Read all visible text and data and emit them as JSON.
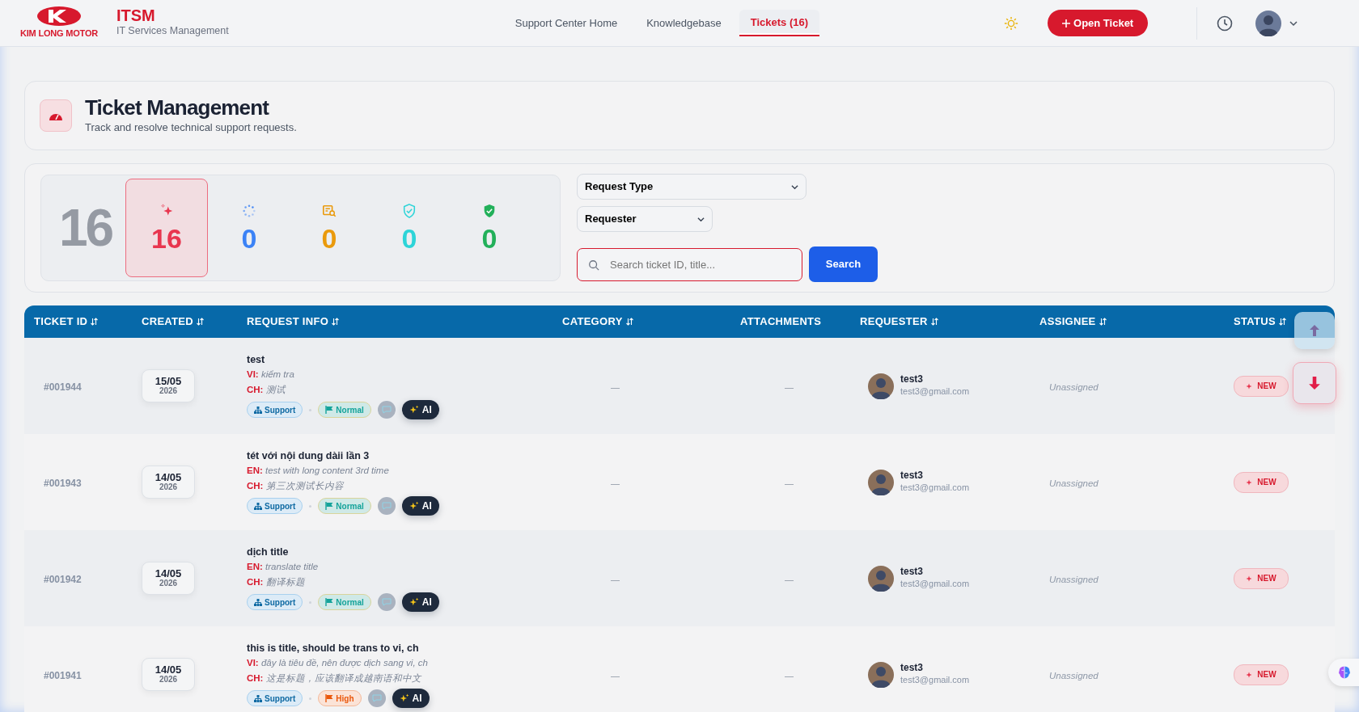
{
  "header": {
    "logo_text": "KIM LONG MOTOR",
    "app_title": "ITSM",
    "app_subtitle": "IT Services Management",
    "open_ticket": "Open Ticket"
  },
  "nav": [
    {
      "label": "Support Center Home",
      "selected": false
    },
    {
      "label": "Knowledgebase",
      "selected": false
    },
    {
      "label": "Tickets (16)",
      "selected": true
    }
  ],
  "page": {
    "title": "Ticket Management",
    "subtitle": "Track and resolve technical support requests."
  },
  "stats": {
    "total": "16",
    "items": [
      {
        "kind": "new",
        "value": "16",
        "color": "#e8364f",
        "selected": true
      },
      {
        "kind": "progress",
        "value": "0",
        "color": "#3b82f6",
        "selected": false
      },
      {
        "kind": "review",
        "value": "0",
        "color": "#ea9a0c",
        "selected": false
      },
      {
        "kind": "resolved",
        "value": "0",
        "color": "#2dd4d8",
        "selected": false
      },
      {
        "kind": "closed",
        "value": "0",
        "color": "#22b05a",
        "selected": false
      }
    ]
  },
  "filters": [
    {
      "label": "Request Type"
    },
    {
      "label": "Requester"
    }
  ],
  "search": {
    "placeholder": "Search ticket ID, title...",
    "button": "Search"
  },
  "table": {
    "columns": [
      {
        "label": "TICKET ID",
        "sortable": true
      },
      {
        "label": "CREATED",
        "sortable": true
      },
      {
        "label": "REQUEST INFO",
        "sortable": true
      },
      {
        "label": "CATEGORY",
        "sortable": true
      },
      {
        "label": "ATTACHMENTS",
        "sortable": false
      },
      {
        "label": "REQUESTER",
        "sortable": true
      },
      {
        "label": "ASSIGNEE",
        "sortable": true
      },
      {
        "label": "STATUS",
        "sortable": true
      }
    ],
    "rows": [
      {
        "id": "#001944",
        "day": "15/05",
        "year": "2026",
        "title": "test",
        "translations": [
          {
            "lang": "VI:",
            "text": "kiểm tra"
          },
          {
            "lang": "CH:",
            "text": "测试"
          }
        ],
        "type": "Support",
        "priority": {
          "kind": "normal",
          "label": "Normal"
        },
        "ai": "AI",
        "category": "—",
        "attachments": "—",
        "requester": "test3",
        "email": "test3@gmail.com",
        "assignee": "Unassigned",
        "status": "NEW"
      },
      {
        "id": "#001943",
        "day": "14/05",
        "year": "2026",
        "title": "tét với nội dung dàii lần 3",
        "translations": [
          {
            "lang": "EN:",
            "text": "test with long content 3rd time"
          },
          {
            "lang": "CH:",
            "text": "第三次测试长内容"
          }
        ],
        "type": "Support",
        "priority": {
          "kind": "normal",
          "label": "Normal"
        },
        "ai": "AI",
        "category": "—",
        "attachments": "—",
        "requester": "test3",
        "email": "test3@gmail.com",
        "assignee": "Unassigned",
        "status": "NEW"
      },
      {
        "id": "#001942",
        "day": "14/05",
        "year": "2026",
        "title": "dịch title",
        "translations": [
          {
            "lang": "EN:",
            "text": "translate title"
          },
          {
            "lang": "CH:",
            "text": "翻译标题"
          }
        ],
        "type": "Support",
        "priority": {
          "kind": "normal",
          "label": "Normal"
        },
        "ai": "AI",
        "category": "—",
        "attachments": "—",
        "requester": "test3",
        "email": "test3@gmail.com",
        "assignee": "Unassigned",
        "status": "NEW"
      },
      {
        "id": "#001941",
        "day": "14/05",
        "year": "2026",
        "title": "this is title, should be trans to vi, ch",
        "translations": [
          {
            "lang": "VI:",
            "text": "đây là tiêu đề, nên được dịch sang vi, ch"
          },
          {
            "lang": "CH:",
            "text": "这是标题，应该翻译成越南语和中文"
          }
        ],
        "type": "Support",
        "priority": {
          "kind": "high",
          "label": "High"
        },
        "ai": "AI",
        "category": "—",
        "attachments": "—",
        "requester": "test3",
        "email": "test3@gmail.com",
        "assignee": "Unassigned",
        "status": "NEW"
      }
    ]
  }
}
